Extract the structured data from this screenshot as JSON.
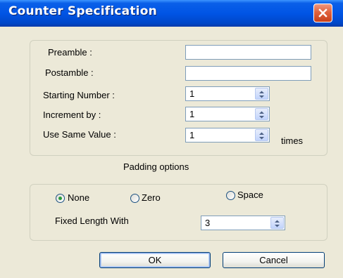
{
  "window": {
    "title": "Counter Specification",
    "close_icon": "close-icon"
  },
  "fields": {
    "preamble": {
      "label": "Preamble :",
      "value": ""
    },
    "postamble": {
      "label": "Postamble :",
      "value": ""
    },
    "starting_number": {
      "label": "Starting Number :",
      "value": "1"
    },
    "increment_by": {
      "label": "Increment by :",
      "value": "1"
    },
    "use_same_value": {
      "label": "Use Same Value :",
      "value": "1",
      "suffix": "times"
    }
  },
  "padding": {
    "title": "Padding options",
    "options": [
      {
        "label": "None",
        "selected": true
      },
      {
        "label": "Zero",
        "selected": false
      },
      {
        "label": "Space",
        "selected": false
      }
    ],
    "fixed_length": {
      "label": "Fixed Length With",
      "value": "3"
    }
  },
  "buttons": {
    "ok": "OK",
    "cancel": "Cancel"
  }
}
